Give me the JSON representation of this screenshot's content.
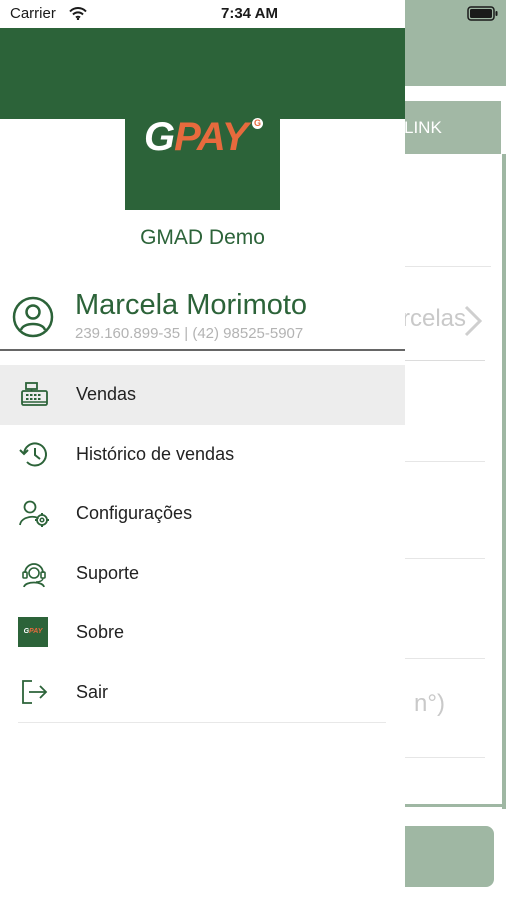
{
  "status_bar": {
    "carrier": "Carrier",
    "time": "7:34 AM"
  },
  "background": {
    "link_button": "LINK",
    "parcelas_text": "rcelas",
    "numero_text": "n°)"
  },
  "logo": {
    "text_g": "G",
    "text_pay": "PAY",
    "badge": "G"
  },
  "store": {
    "name": "GMAD Demo"
  },
  "user": {
    "name": "Marcela Morimoto",
    "details": "239.160.899-35 | (42) 98525-5907"
  },
  "menu": {
    "items": [
      {
        "label": "Vendas",
        "icon": "cash-register-icon",
        "active": true
      },
      {
        "label": "Histórico de vendas",
        "icon": "history-icon"
      },
      {
        "label": "Configurações",
        "icon": "user-settings-icon"
      },
      {
        "label": "Suporte",
        "icon": "support-headset-icon"
      },
      {
        "label": "Sobre",
        "icon": "gpay-logo-icon"
      },
      {
        "label": "Sair",
        "icon": "logout-icon"
      }
    ]
  },
  "colors": {
    "brand_green": "#2c6339",
    "accent_orange": "#e76a3d",
    "faded_green": "#9fb7a3"
  }
}
